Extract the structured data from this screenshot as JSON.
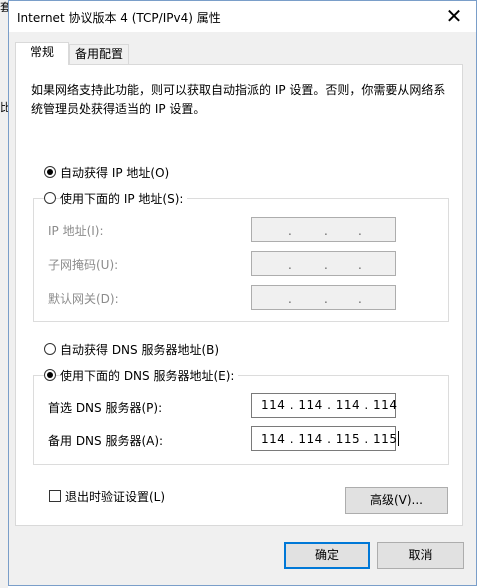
{
  "window": {
    "title": "Internet 协议版本 4 (TCP/IPv4) 属性",
    "close_glyph": "✕"
  },
  "tabs": [
    {
      "label": "常规"
    },
    {
      "label": "备用配置"
    }
  ],
  "description": "如果网络支持此功能，则可以获取自动指派的 IP 设置。否则，你需要从网络系统管理员处获得适当的 IP 设置。",
  "ip": {
    "auto_label": "自动获得 IP 地址(O)",
    "manual_label": "使用下面的 IP 地址(S):",
    "address_label": "IP 地址(I):",
    "subnet_label": "子网掩码(U):",
    "gateway_label": "默认网关(D):"
  },
  "dns": {
    "auto_label": "自动获得 DNS 服务器地址(B)",
    "manual_label": "使用下面的 DNS 服务器地址(E):",
    "preferred_label": "首选 DNS 服务器(P):",
    "preferred_value": "114 . 114 . 114 . 114",
    "alternate_label": "备用 DNS 服务器(A):",
    "alternate_value": "114 . 114 . 115 . 115"
  },
  "validate_label": "退出时验证设置(L)",
  "advanced_label": "高级(V)...",
  "ok_label": "确定",
  "cancel_label": "取消",
  "bg_strip": [
    "套",
    "比"
  ]
}
